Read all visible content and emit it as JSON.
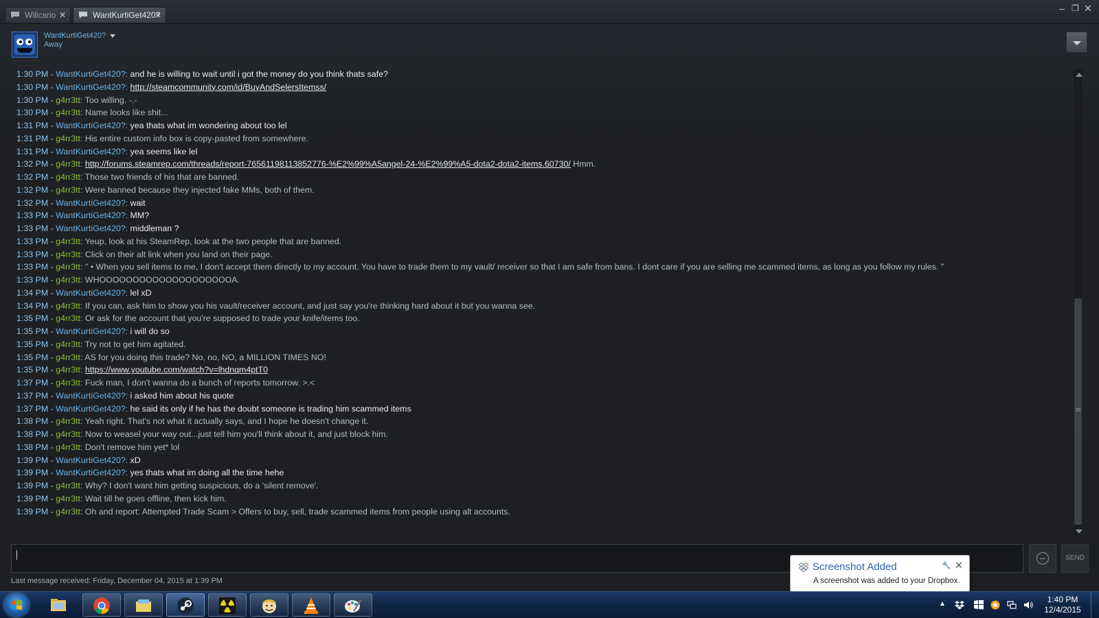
{
  "tabs": [
    {
      "label": "Willcario",
      "active": false
    },
    {
      "label": "WantKurtiGet420?",
      "active": true
    }
  ],
  "window_controls": {
    "minimize": "–",
    "maximize": "❐",
    "close": "✕"
  },
  "friend": {
    "name": "WantKurtiGet420?",
    "status": "Away"
  },
  "colors": {
    "self_name": "#6cb4e4",
    "other_name": "#8fbc3b",
    "timestamp": "#8ec6ee",
    "background": "#1e2024"
  },
  "messages": [
    {
      "time": "1:30 PM",
      "sender": "WantKurtiGet420?",
      "self": true,
      "text": "and he is willing to wait until i got the money do you think thats safe?"
    },
    {
      "time": "1:30 PM",
      "sender": "WantKurtiGet420?",
      "self": true,
      "text": "",
      "link": "http://steamcommunity.com/id/BuyAndSelersItemss/"
    },
    {
      "time": "1:30 PM",
      "sender": "g4rr3tt",
      "self": false,
      "text": "Too willing. -.-"
    },
    {
      "time": "1:30 PM",
      "sender": "g4rr3tt",
      "self": false,
      "text": "Name looks like shit..."
    },
    {
      "time": "1:31 PM",
      "sender": "WantKurtiGet420?",
      "self": true,
      "text": "yea thats what im wondering about too lel"
    },
    {
      "time": "1:31 PM",
      "sender": "g4rr3tt",
      "self": false,
      "text": "His entire custom info box is copy-pasted from somewhere."
    },
    {
      "time": "1:31 PM",
      "sender": "WantKurtiGet420?",
      "self": true,
      "text": "yea seems like lel"
    },
    {
      "time": "1:32 PM",
      "sender": "g4rr3tt",
      "self": false,
      "text": "",
      "link": "http://forums.steamrep.com/threads/report-76561198113852776-%E2%99%A5angel-24-%E2%99%A5-dota2-dota2-items.60730/",
      "after": " Hmm."
    },
    {
      "time": "1:32 PM",
      "sender": "g4rr3tt",
      "self": false,
      "text": "Those two friends of his that are banned."
    },
    {
      "time": "1:32 PM",
      "sender": "g4rr3tt",
      "self": false,
      "text": "Were banned because they injected fake MMs, both of them."
    },
    {
      "time": "1:32 PM",
      "sender": "WantKurtiGet420?",
      "self": true,
      "text": "wait"
    },
    {
      "time": "1:33 PM",
      "sender": "WantKurtiGet420?",
      "self": true,
      "text": "MM?"
    },
    {
      "time": "1:33 PM",
      "sender": "WantKurtiGet420?",
      "self": true,
      "text": "middleman ?"
    },
    {
      "time": "1:33 PM",
      "sender": "g4rr3tt",
      "self": false,
      "text": "Yeup, look at his SteamRep, look at the two people that are banned."
    },
    {
      "time": "1:33 PM",
      "sender": "g4rr3tt",
      "self": false,
      "text": "Click on their alt link when you land on their page."
    },
    {
      "time": "1:33 PM",
      "sender": "g4rr3tt",
      "self": false,
      "text": "\" • When you sell items to me, I don't accept them directly to my account. You have to trade them to my vault/ receiver so that I am safe from bans. I dont care if you are selling me scammed items, as long as you follow my rules. \""
    },
    {
      "time": "1:33 PM",
      "sender": "g4rr3tt",
      "self": false,
      "text": "WHOOOOOOOOOOOOOOOOOOOOA."
    },
    {
      "time": "1:34 PM",
      "sender": "WantKurtiGet420?",
      "self": true,
      "text": "lel xD"
    },
    {
      "time": "1:34 PM",
      "sender": "g4rr3tt",
      "self": false,
      "text": "If you can, ask him to show you his vault/receiver account, and just say you're thinking hard about it but you wanna see."
    },
    {
      "time": "1:35 PM",
      "sender": "g4rr3tt",
      "self": false,
      "text": "Or ask for the account that you're supposed to trade your knife/items too."
    },
    {
      "time": "1:35 PM",
      "sender": "WantKurtiGet420?",
      "self": true,
      "text": "i will do so"
    },
    {
      "time": "1:35 PM",
      "sender": "g4rr3tt",
      "self": false,
      "text": "Try not to get him agitated."
    },
    {
      "time": "1:35 PM",
      "sender": "g4rr3tt",
      "self": false,
      "text": "AS for you doing this trade? No, no, NO, a MILLION TIMES NO!"
    },
    {
      "time": "1:35 PM",
      "sender": "g4rr3tt",
      "self": false,
      "text": "",
      "link": "https://www.youtube.com/watch?v=lhdnqm4ptT0"
    },
    {
      "time": "1:37 PM",
      "sender": "g4rr3tt",
      "self": false,
      "text": "Fuck man, I don't wanna do a bunch of reports tomorrow. >.<"
    },
    {
      "time": "1:37 PM",
      "sender": "WantKurtiGet420?",
      "self": true,
      "text": "i asked him about his quote"
    },
    {
      "time": "1:37 PM",
      "sender": "WantKurtiGet420?",
      "self": true,
      "text": "he said its only if he has the doubt someone is trading him scammed items"
    },
    {
      "time": "1:38 PM",
      "sender": "g4rr3tt",
      "self": false,
      "text": "Yeah right. That's not what it actually says, and I hope he doesn't change it."
    },
    {
      "time": "1:38 PM",
      "sender": "g4rr3tt",
      "self": false,
      "text": "Now to weasel your way out...just tell him you'll think about it, and just block him."
    },
    {
      "time": "1:38 PM",
      "sender": "g4rr3tt",
      "self": false,
      "text": "Don't remove him yet* lol"
    },
    {
      "time": "1:39 PM",
      "sender": "WantKurtiGet420?",
      "self": true,
      "text": "xD"
    },
    {
      "time": "1:39 PM",
      "sender": "WantKurtiGet420?",
      "self": true,
      "text": "yes thats what im doing all the time hehe"
    },
    {
      "time": "1:39 PM",
      "sender": "g4rr3tt",
      "self": false,
      "text": "Why? I don't want him getting suspicious, do a 'silent remove'."
    },
    {
      "time": "1:39 PM",
      "sender": "g4rr3tt",
      "self": false,
      "text": "Wait till he goes offline, then kick him."
    },
    {
      "time": "1:39 PM",
      "sender": "g4rr3tt",
      "self": false,
      "text": "Oh and report: Attempted Trade Scam > Offers to buy, sell, trade scammed items from people using alt accounts."
    }
  ],
  "composer": {
    "send_label": "SEND",
    "value": ""
  },
  "last_message": "Last message received: Friday, December 04, 2015 at 1:39 PM",
  "toast": {
    "title": "Screenshot Added",
    "body": "A screenshot was added to your Dropbox."
  },
  "taskbar": {
    "apps": [
      "explorer-icon",
      "chrome-icon",
      "windows-explorer-icon",
      "steam-icon",
      "fallout-icon",
      "vault-boy-icon",
      "vlc-icon",
      "paint-icon"
    ],
    "clock_time": "1:40 PM",
    "clock_date": "12/4/2015"
  }
}
